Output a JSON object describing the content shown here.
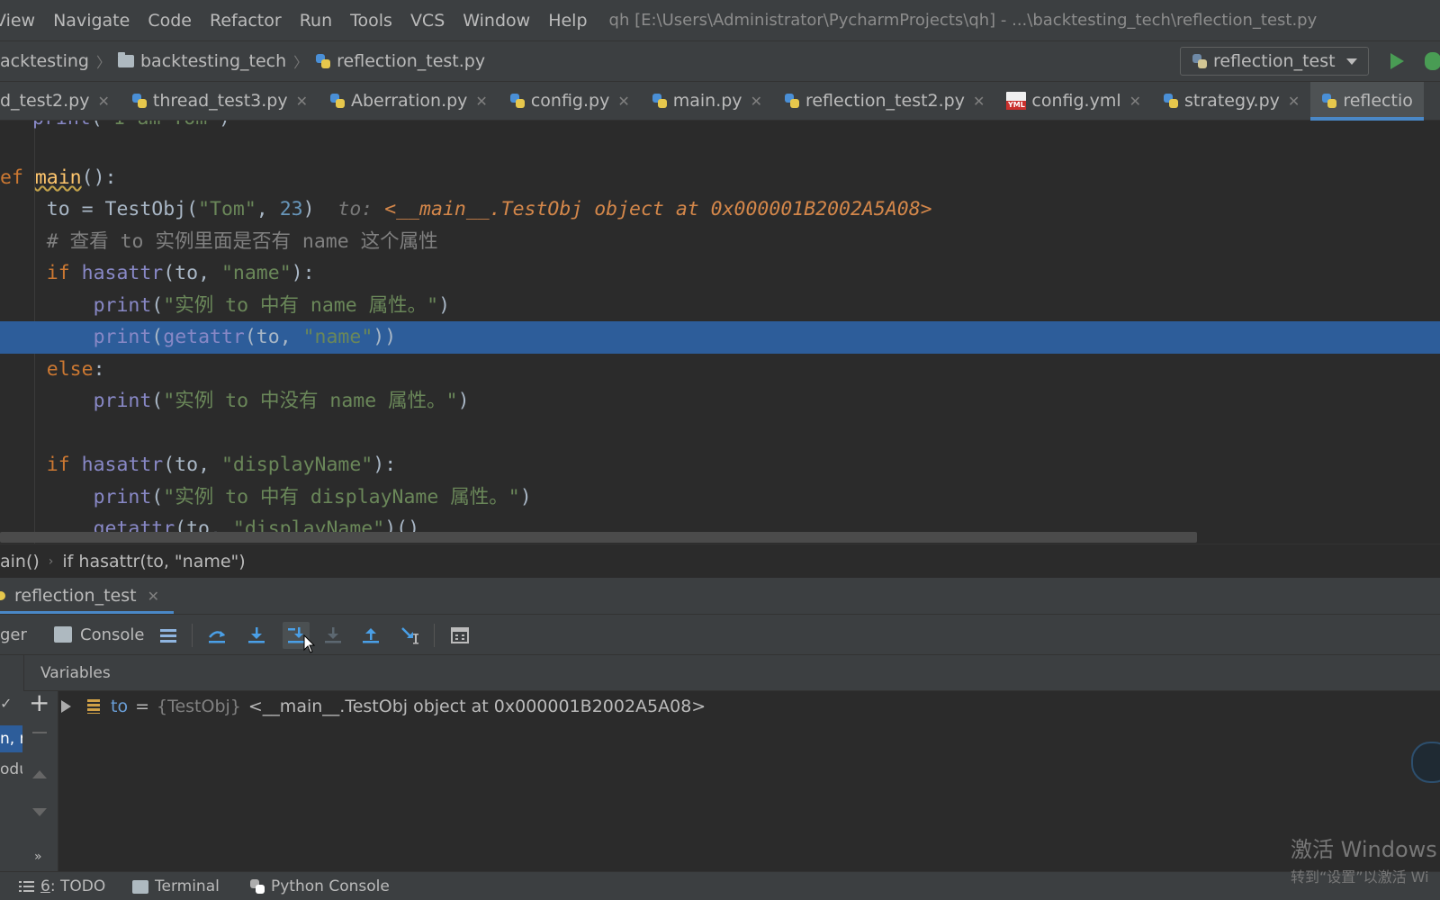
{
  "menu": {
    "items": [
      "View",
      "Navigate",
      "Code",
      "Refactor",
      "Run",
      "Tools",
      "VCS",
      "Window",
      "Help"
    ],
    "title": "qh [E:\\Users\\Administrator\\PycharmProjects\\qh] - ...\\backtesting_tech\\reflection_test.py"
  },
  "breadcrumb": {
    "items": [
      "acktesting",
      "backtesting_tech",
      "reflection_test.py"
    ]
  },
  "run_config": {
    "label": "reflection_test"
  },
  "tabs": [
    {
      "label": "d_test2.py"
    },
    {
      "label": "thread_test3.py"
    },
    {
      "label": "Aberration.py"
    },
    {
      "label": "config.py"
    },
    {
      "label": "main.py"
    },
    {
      "label": "reflection_test2.py"
    },
    {
      "label": "config.yml"
    },
    {
      "label": "strategy.py"
    },
    {
      "label": "reflectio",
      "active": true
    }
  ],
  "editor": {
    "hint_to_label": "to:",
    "hint_to_value": "<__main__.TestObj object at 0x000001B2002A5A08>",
    "comment": "# 查看 to 实例里面是否有 name 这个属性",
    "str_tom": "\"Tom\"",
    "num_23": "23",
    "str_name": "\"name\"",
    "str_has_name": "\"实例 to 中有 name 属性。\"",
    "str_no_name": "\"实例 to 中没有 name 属性。\"",
    "str_display": "\"displayName\"",
    "str_has_display": "\"实例 to 中有 displayName 属性。\""
  },
  "code_breadcrumb": {
    "func": "ain()",
    "stmt": "if hasattr(to, \"name\")"
  },
  "debug": {
    "session_tab": "reflection_test",
    "tab_debugger": "ger",
    "tab_console": "Console",
    "variables_title": "Variables",
    "variable": {
      "name": "to",
      "eq": "=",
      "type": "{TestObj}",
      "value": "<__main__.TestObj object at 0x000001B2002A5A08>"
    },
    "frames_partial": [
      "n, r",
      "odu"
    ]
  },
  "status": {
    "todo_num": "6",
    "todo_label": ": TODO",
    "terminal": "Terminal",
    "python_console": "Python Console"
  },
  "watermark": {
    "line1": "激活 Windows",
    "line2": "转到“设置”以激活 Wi"
  },
  "colors": {
    "editor_bg": "#2b2b2b",
    "panel_bg": "#3c3f41",
    "selection": "#2d5d9a",
    "accent": "#4a88c7",
    "keyword": "#cc7832",
    "string": "#6a8759",
    "function": "#ffc66d",
    "builtin": "#8888c6",
    "number": "#6897bb"
  }
}
